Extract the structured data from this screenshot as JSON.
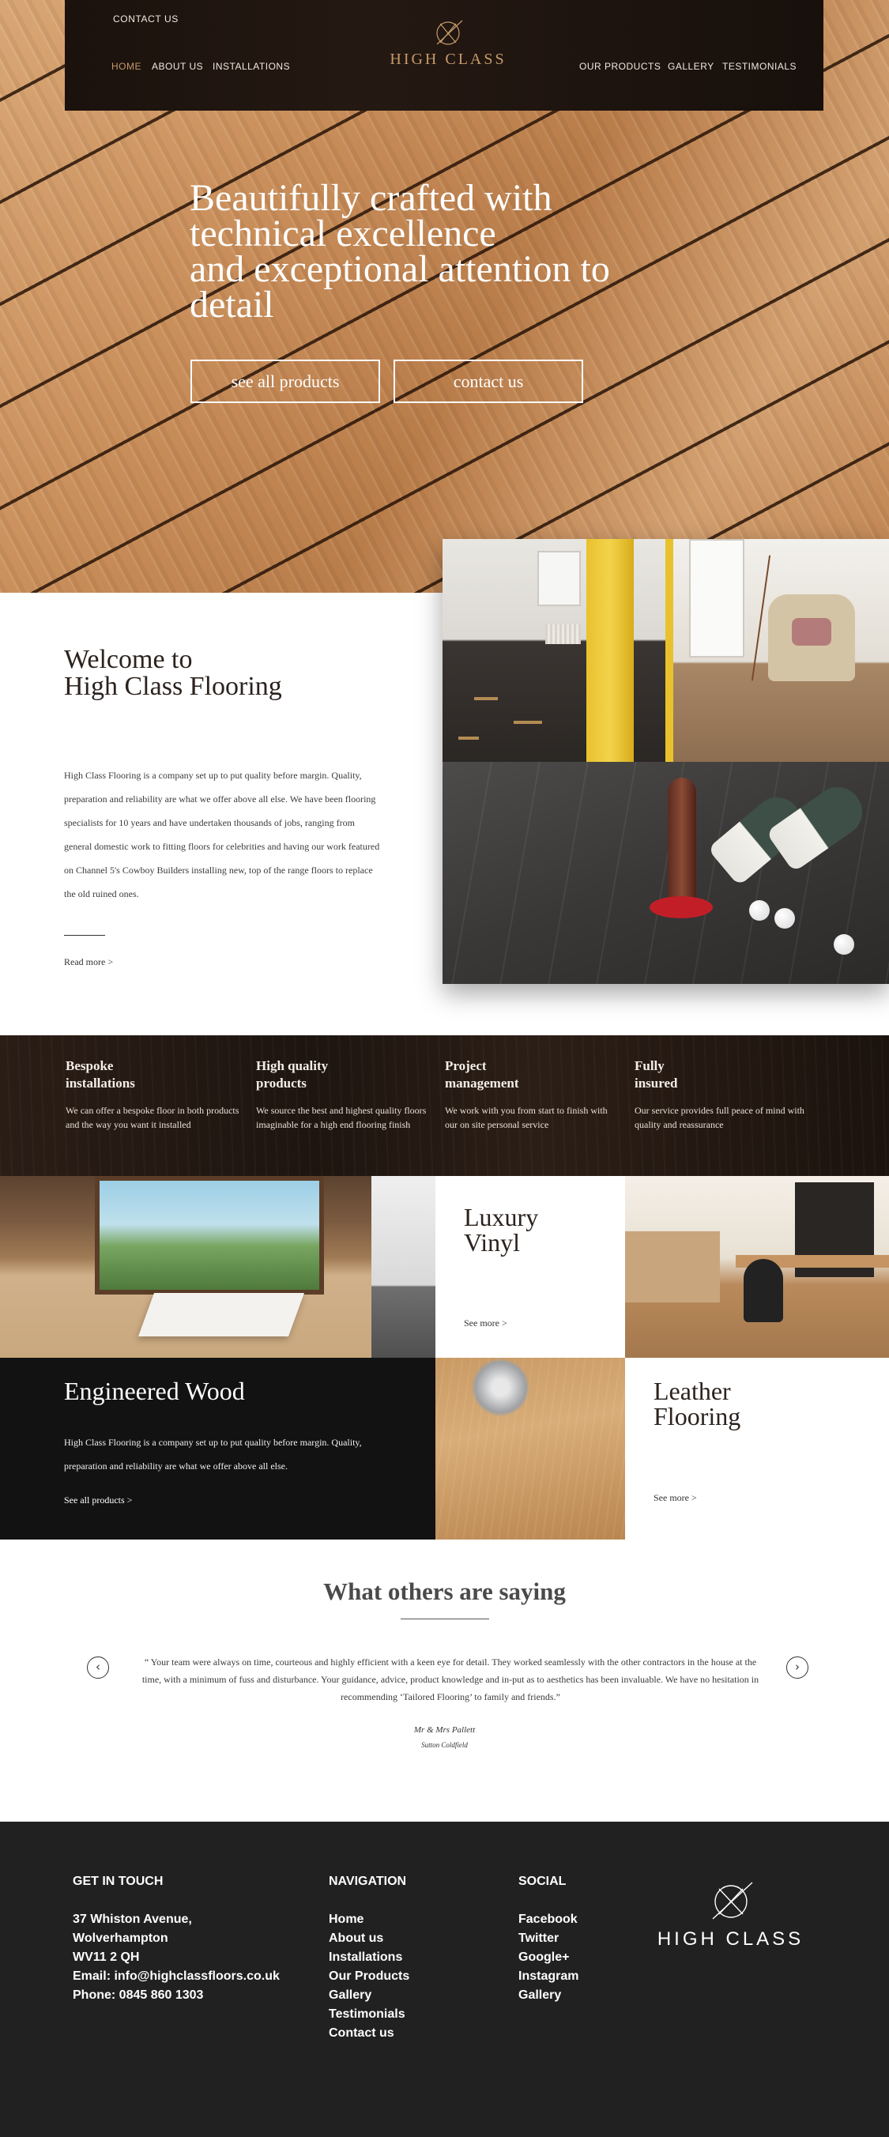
{
  "header": {
    "contact_us": "CONTACT US",
    "nav_left": [
      "HOME",
      "ABOUT US",
      "INSTALLATIONS"
    ],
    "nav_right": [
      "OUR PRODUCTS",
      "GALLERY",
      "TESTIMONIALS"
    ],
    "logo_text": "HIGH CLASS",
    "accent_color": "#c69a6a"
  },
  "hero": {
    "title_lines": [
      "Beautifully crafted with",
      "technical excellence",
      "and exceptional attention to",
      "detail"
    ],
    "buttons": [
      "see all products",
      "contact us"
    ]
  },
  "welcome": {
    "title_lines": [
      "Welcome to",
      "High Class Flooring"
    ],
    "body": "High Class Flooring is a company set up to put quality before margin. Quality, preparation and reliability are what we offer above all else. We have been flooring specialists for 10 years and have undertaken thousands of jobs, ranging from general domestic work to fitting floors for celebrities and having our work featured on Channel 5's Cowboy Builders installing new, top of the range floors to replace the old ruined ones.",
    "read_more": "Read more >"
  },
  "features": [
    {
      "title_lines": [
        "Bespoke",
        "installations"
      ],
      "text": "We can offer a bespoke floor in both products and the way you want it installed"
    },
    {
      "title_lines": [
        "High quality",
        "products"
      ],
      "text": "We source the best and highest quality floors imaginable for a high end flooring finish"
    },
    {
      "title_lines": [
        "Project",
        "management"
      ],
      "text": "We work with you from start to finish with our on site personal service"
    },
    {
      "title_lines": [
        "Fully",
        "insured"
      ],
      "text": "Our service provides full peace of mind with quality and reassurance"
    }
  ],
  "products": {
    "vinyl": {
      "title_lines": [
        "Luxury",
        "Vinyl"
      ],
      "see_more": "See more >"
    },
    "engineered": {
      "title": "Engineered Wood",
      "text": "High Class Flooring is a company set up to put quality before margin. Quality, preparation and reliability are what we offer above all else.",
      "link": "See all products >"
    },
    "leather": {
      "title_lines": [
        "Leather",
        "Flooring"
      ],
      "see_more": "See more >"
    }
  },
  "testimonials": {
    "title": "What others are saying",
    "quote": "“ Your team were always on time, courteous and highly efficient with a keen eye for detail. They worked seamlessly with the other contractors in the house at the time, with a minimum of fuss and disturbance. Your guidance, advice, product knowledge and in-put as to aesthetics has been invaluable. We have no hesitation in recommending ‘Tailored Flooring’ to family and friends.”",
    "author": "Mr & Mrs Pallett",
    "location": "Sutton Coldfield",
    "prev_icon": "chevron-left-icon",
    "next_icon": "chevron-right-icon"
  },
  "footer": {
    "contact": {
      "heading": "GET IN TOUCH",
      "lines": [
        "37 Whiston Avenue,",
        "Wolverhampton",
        "WV11 2 QH",
        "Email: info@highclassfloors.co.uk",
        "Phone: 0845 860 1303"
      ]
    },
    "navigation": {
      "heading": "NAVIGATION",
      "links": [
        "Home",
        "About us",
        "Installations",
        "Our Products",
        "Gallery",
        "Testimonials",
        "Contact us"
      ]
    },
    "social": {
      "heading": "SOCIAL",
      "links": [
        "Facebook",
        "Twitter",
        "Google+",
        "Instagram",
        "Gallery"
      ]
    },
    "logo_text": "HIGH CLASS"
  }
}
